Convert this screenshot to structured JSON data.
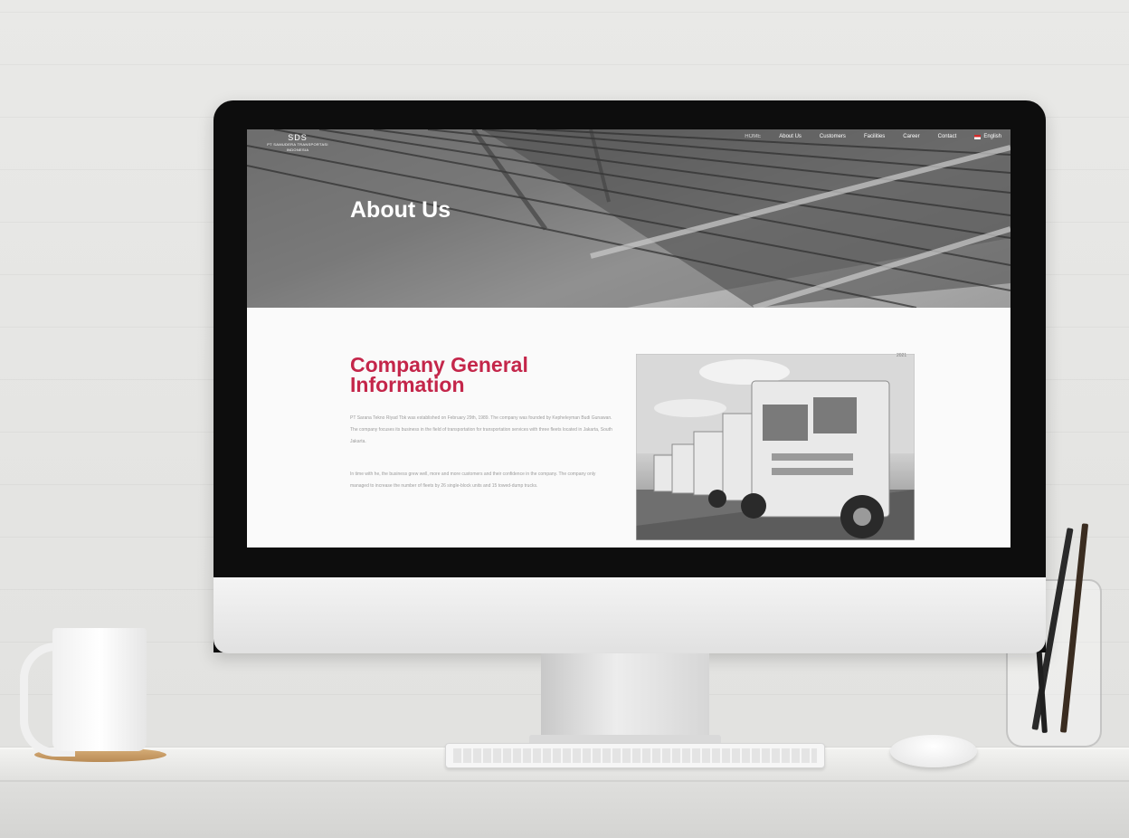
{
  "website": {
    "logo_mark": "SDS",
    "logo_name": "PT SAMUDERA TRANSPORTASI INDONESIA",
    "nav": {
      "items": [
        "HOME",
        "About Us",
        "Customers",
        "Facilities",
        "Career",
        "Contact"
      ],
      "language": "English"
    },
    "hero": {
      "title": "About Us"
    },
    "section": {
      "heading": "Company General Information",
      "paragraph1": "PT Sarana Tekno Riyad Tbk was established on February 29th, 1989. The company was founded by Kepheleyman Budi Gunawan. The company focuses its business in the field of transportation for transportation services with three fleets located in Jakarta, South Jakarta.",
      "paragraph2": "In time with he, the business grew well, more and more customers and their confidence in the company. The company only managed to increase the number of fleets by 26 single-block units and 15 towed-dump trucks.",
      "photo_label": "2021"
    }
  },
  "colors": {
    "accent": "#c4264a",
    "body_text": "#9c9c9c",
    "hero_title": "#ffffff"
  }
}
